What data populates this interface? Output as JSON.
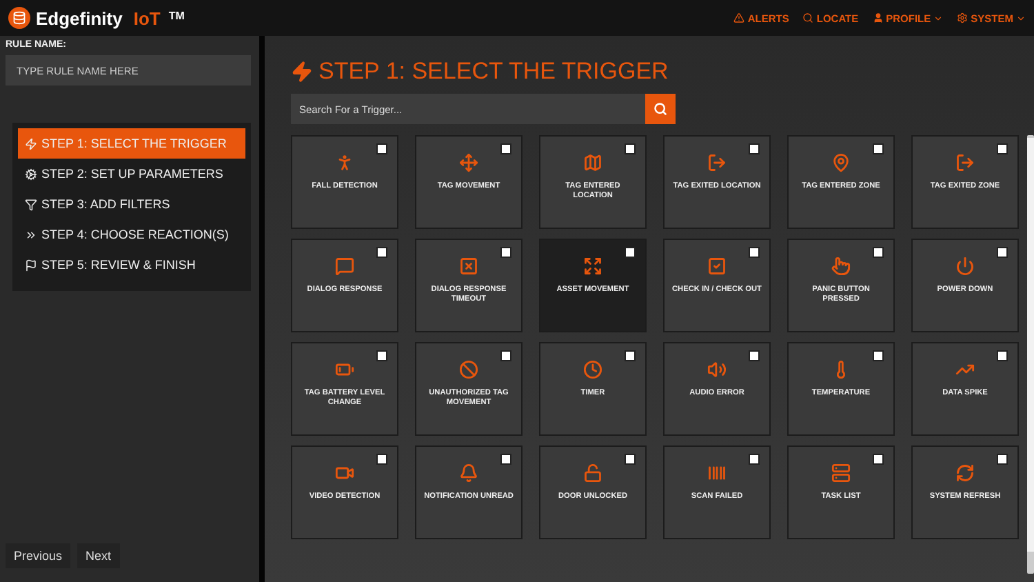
{
  "app": {
    "name": "Edgefinity",
    "name_accent": "IoT",
    "trademark": "TM"
  },
  "nav": [
    {
      "label": "ALERTS",
      "dropdown": false
    },
    {
      "label": "LOCATE",
      "dropdown": false
    },
    {
      "label": "PROFILE",
      "dropdown": true
    },
    {
      "label": "SYSTEM",
      "dropdown": true
    }
  ],
  "sidebar": {
    "rule_name_label": "RULE NAME:",
    "rule_name_placeholder": "TYPE RULE NAME HERE",
    "steps": [
      {
        "label": "STEP 1: SELECT THE TRIGGER",
        "selected": true
      },
      {
        "label": "STEP 2: SET UP PARAMETERS",
        "selected": false
      },
      {
        "label": "STEP 3: ADD FILTERS",
        "selected": false
      },
      {
        "label": "STEP 4: CHOOSE REACTION(S)",
        "selected": false
      },
      {
        "label": "STEP 5: REVIEW & FINISH",
        "selected": false
      }
    ],
    "buttons": [
      "Previous",
      "Next"
    ]
  },
  "main": {
    "title": "STEP 1: SELECT THE TRIGGER",
    "search_placeholder": "Search For a Trigger...",
    "triggers": [
      {
        "label": "FALL DETECTION",
        "selected": false,
        "checked": false
      },
      {
        "label": "TAG MOVEMENT",
        "selected": false,
        "checked": false
      },
      {
        "label": "TAG ENTERED LOCATION",
        "selected": false,
        "checked": false
      },
      {
        "label": "TAG EXITED LOCATION",
        "selected": false,
        "checked": false
      },
      {
        "label": "TAG ENTERED ZONE",
        "selected": false,
        "checked": false
      },
      {
        "label": "TAG EXITED ZONE",
        "selected": false,
        "checked": false
      },
      {
        "label": "DIALOG RESPONSE",
        "selected": false,
        "checked": false
      },
      {
        "label": "DIALOG RESPONSE TIMEOUT",
        "selected": false,
        "checked": false
      },
      {
        "label": "ASSET MOVEMENT",
        "selected": true,
        "checked": false
      },
      {
        "label": "CHECK IN / CHECK OUT",
        "selected": false,
        "checked": false
      },
      {
        "label": "PANIC BUTTON PRESSED",
        "selected": false,
        "checked": false
      },
      {
        "label": "POWER DOWN",
        "selected": false,
        "checked": false
      },
      {
        "label": "TAG BATTERY LEVEL CHANGE",
        "selected": false,
        "checked": false
      },
      {
        "label": "UNAUTHORIZED TAG MOVEMENT",
        "selected": false,
        "checked": false
      },
      {
        "label": "TIMER",
        "selected": false,
        "checked": false
      },
      {
        "label": "AUDIO ERROR",
        "selected": false,
        "checked": false
      },
      {
        "label": "TEMPERATURE",
        "selected": false,
        "checked": false
      },
      {
        "label": "DATA SPIKE",
        "selected": false,
        "checked": false
      },
      {
        "label": "VIDEO DETECTION",
        "selected": false,
        "checked": false
      },
      {
        "label": "NOTIFICATION UNREAD",
        "selected": false,
        "checked": false
      },
      {
        "label": "DOOR UNLOCKED",
        "selected": false,
        "checked": false
      },
      {
        "label": "SCAN FAILED",
        "selected": false,
        "checked": false
      },
      {
        "label": "TASK LIST",
        "selected": false,
        "checked": false
      },
      {
        "label": "SYSTEM REFRESH",
        "selected": false,
        "checked": false
      }
    ]
  }
}
